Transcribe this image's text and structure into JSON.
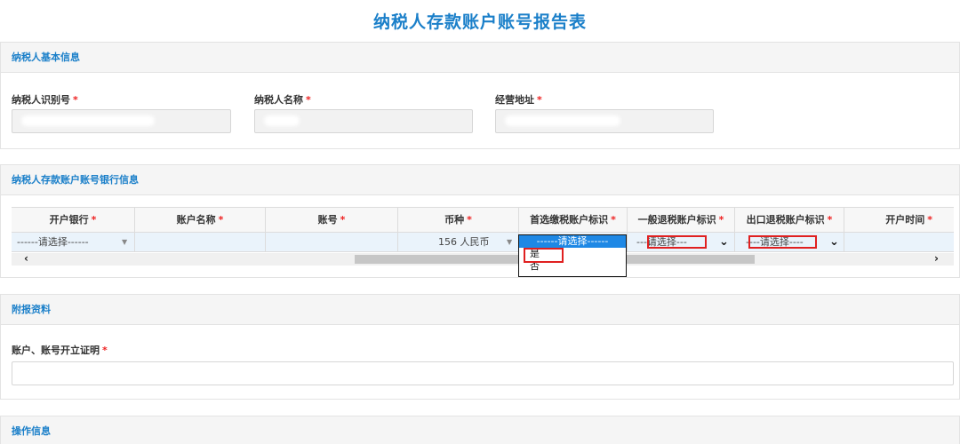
{
  "page_title": "纳税人存款账户账号报告表",
  "basic": {
    "header": "纳税人基本信息",
    "fields": [
      {
        "label": "纳税人识别号",
        "required": "*"
      },
      {
        "label": "纳税人名称",
        "required": "*"
      },
      {
        "label": "经营地址",
        "required": "*"
      }
    ]
  },
  "bank": {
    "header": "纳税人存款账户账号银行信息",
    "columns": [
      {
        "label": "开户银行",
        "required": "*"
      },
      {
        "label": "账户名称",
        "required": "*"
      },
      {
        "label": "账号",
        "required": "*"
      },
      {
        "label": "币种",
        "required": "*"
      },
      {
        "label": "首选缴税账户标识",
        "required": "*"
      },
      {
        "label": "一般退税账户标识",
        "required": "*"
      },
      {
        "label": "出口退税账户标识",
        "required": "*"
      },
      {
        "label": "开户时间",
        "required": "*"
      }
    ],
    "row": {
      "bank": "------请选择------",
      "currency": "156 人民币",
      "primary_flag": "------请选择------",
      "general_refund": "---请选择---",
      "export_refund": "----请选择----"
    },
    "dropdown_options": [
      "是",
      "否"
    ],
    "scroll_left": "‹",
    "scroll_right": "›"
  },
  "attach": {
    "header": "附报资料",
    "label": "账户、账号开立证明",
    "required": "*"
  },
  "operation": {
    "header": "操作信息"
  },
  "colors": {
    "accent": "#1a7fc9",
    "required": "#e22222",
    "highlight": "#e02020",
    "selected": "#1e88e5"
  }
}
